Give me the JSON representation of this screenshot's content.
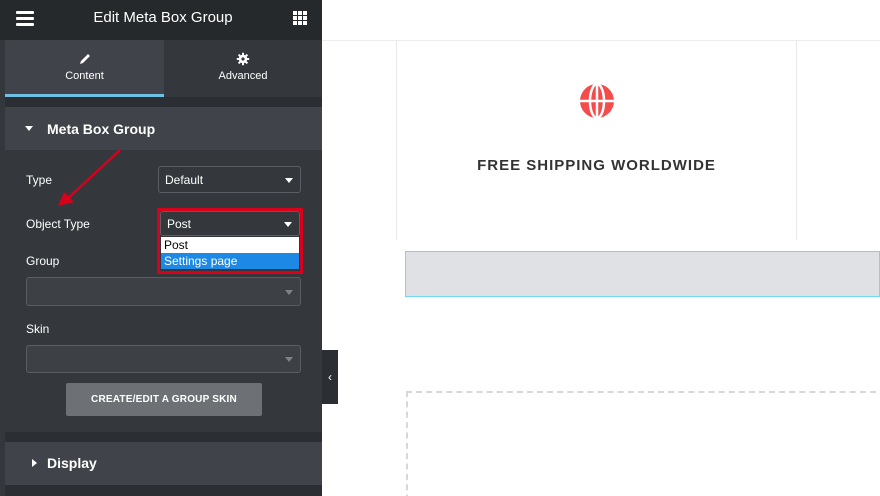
{
  "panel": {
    "title": "Edit Meta Box Group",
    "menu_icon": "hamburger-icon",
    "apps_icon": "grid-icon"
  },
  "tabs": [
    {
      "label": "Content",
      "icon": "pencil-icon",
      "active": true
    },
    {
      "label": "Advanced",
      "icon": "gear-icon",
      "active": false
    }
  ],
  "section": {
    "title": "Meta Box Group",
    "fields": {
      "type": {
        "label": "Type",
        "value": "Default"
      },
      "object_type": {
        "label": "Object Type",
        "value": "Post",
        "options": [
          "Post",
          "Settings page"
        ],
        "highlighted_option": "Settings page"
      },
      "group": {
        "label": "Group",
        "value": ""
      },
      "skin": {
        "label": "Skin",
        "value": ""
      }
    },
    "button_label": "CREATE/EDIT A GROUP SKIN"
  },
  "display_section": {
    "title": "Display"
  },
  "canvas": {
    "feature_title": "FREE SHIPPING WORLDWIDE",
    "feature_icon": "globe-icon"
  },
  "colors": {
    "accent_tab": "#6ec1e4",
    "highlight_red": "#d9001b",
    "option_selected": "#1e88e5",
    "globe_red": "#f44b4b"
  }
}
